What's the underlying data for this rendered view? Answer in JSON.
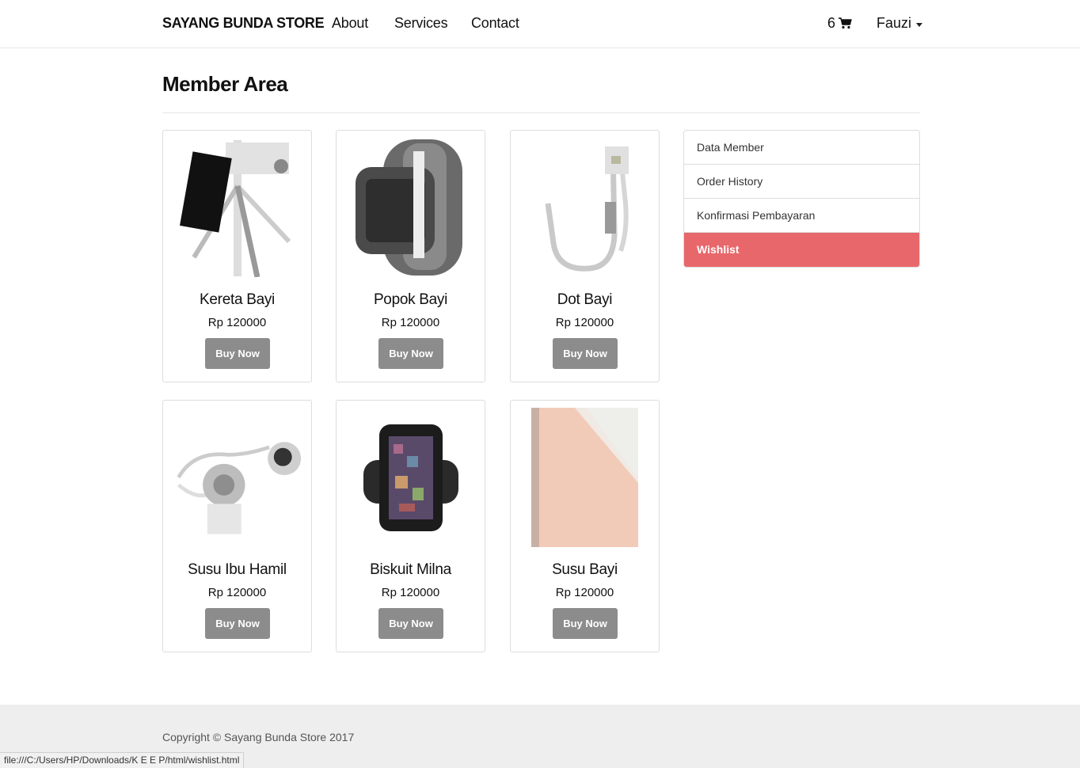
{
  "navbar": {
    "brand": "SAYANG BUNDA STORE",
    "links": [
      "About",
      "Services",
      "Contact"
    ],
    "cart_count": "6",
    "user_name": "Fauzi"
  },
  "page": {
    "title": "Member Area"
  },
  "products": [
    {
      "name": "Kereta Bayi",
      "price": "Rp 120000",
      "button": "Buy Now",
      "icon": "tripod-phone-image"
    },
    {
      "name": "Popok Bayi",
      "price": "Rp 120000",
      "button": "Buy Now",
      "icon": "smartwatch-image"
    },
    {
      "name": "Dot Bayi",
      "price": "Rp 120000",
      "button": "Buy Now",
      "icon": "cable-image"
    },
    {
      "name": "Susu Ibu Hamil",
      "price": "Rp 120000",
      "button": "Buy Now",
      "icon": "earphones-image"
    },
    {
      "name": "Biskuit Milna",
      "price": "Rp 120000",
      "button": "Buy Now",
      "icon": "phone-armband-image"
    },
    {
      "name": "Susu Bayi",
      "price": "Rp 120000",
      "button": "Buy Now",
      "icon": "tablet-case-image"
    }
  ],
  "sidebar": {
    "items": [
      {
        "label": "Data Member",
        "active": false
      },
      {
        "label": "Order History",
        "active": false
      },
      {
        "label": "Konfirmasi Pembayaran",
        "active": false
      },
      {
        "label": "Wishlist",
        "active": true
      }
    ]
  },
  "footer": {
    "copyright": "Copyright © Sayang Bunda Store 2017"
  },
  "status_bar": {
    "url": "file:///C:/Users/HP/Downloads/K E E P/html/wishlist.html"
  },
  "colors": {
    "active_item": "#e8676a",
    "button": "#8c8c8c",
    "footer_bg": "#eeeeee"
  }
}
